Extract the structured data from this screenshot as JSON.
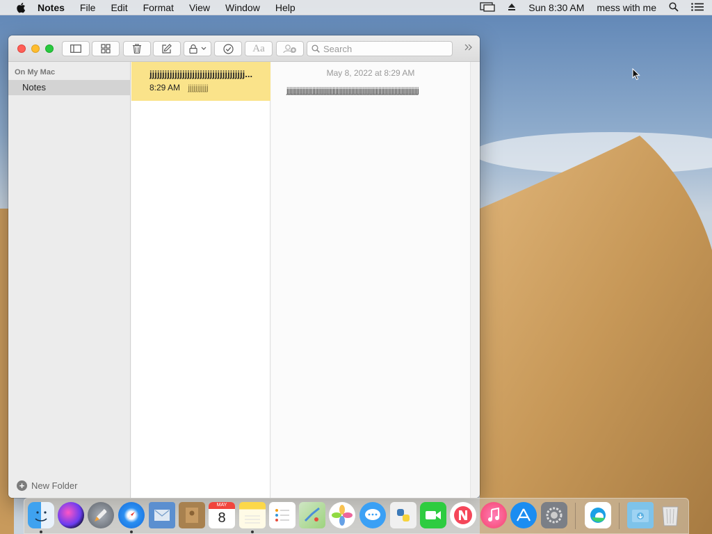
{
  "menubar": {
    "app_name": "Notes",
    "menus": [
      "File",
      "Edit",
      "Format",
      "View",
      "Window",
      "Help"
    ],
    "clock": "Sun 8:30 AM",
    "user": "mess with me"
  },
  "window": {
    "search_placeholder": "Search"
  },
  "sidebar": {
    "section_label": "On My Mac",
    "folder_label": "Notes",
    "new_folder_label": "New Folder"
  },
  "note_list": {
    "notes": [
      {
        "title": "jjjjjjjjjjjjjjjjjjjjjjjjjjjjjjjjjjjjjj...",
        "time": "8:29 AM",
        "preview": "jjjjjjjjjjj"
      }
    ]
  },
  "editor": {
    "date": "May 8, 2022 at 8:29 AM",
    "body": "jjjjjjjjjjjjjjjjjjjjjjjjjjjjjjjjjjjjjjjjjjjjjjjjjjjjjjjjjjjjjjjjjjjjjjjjjjjjjjjjjjjjjjjjjjjj"
  },
  "dock": {
    "apps": [
      "finder-icon",
      "siri-icon",
      "launchpad-icon",
      "safari-icon",
      "mail-icon",
      "contacts-icon",
      "calendar-icon",
      "notes-icon",
      "reminders-icon",
      "maps-icon",
      "photos-icon",
      "messages-icon",
      "python-icon",
      "facetime-icon",
      "news-icon",
      "music-icon",
      "app-store-icon",
      "system-preferences-icon",
      "edge-icon",
      "downloads-folder-icon",
      "trash-icon"
    ],
    "calendar_month": "MAY",
    "calendar_day": "8"
  },
  "colors": {
    "selected_note": "#fae38a",
    "sidebar_selected": "#d3d3d3",
    "close": "#ff5f57",
    "minimize": "#ffbd2e",
    "maximize": "#28c940"
  }
}
